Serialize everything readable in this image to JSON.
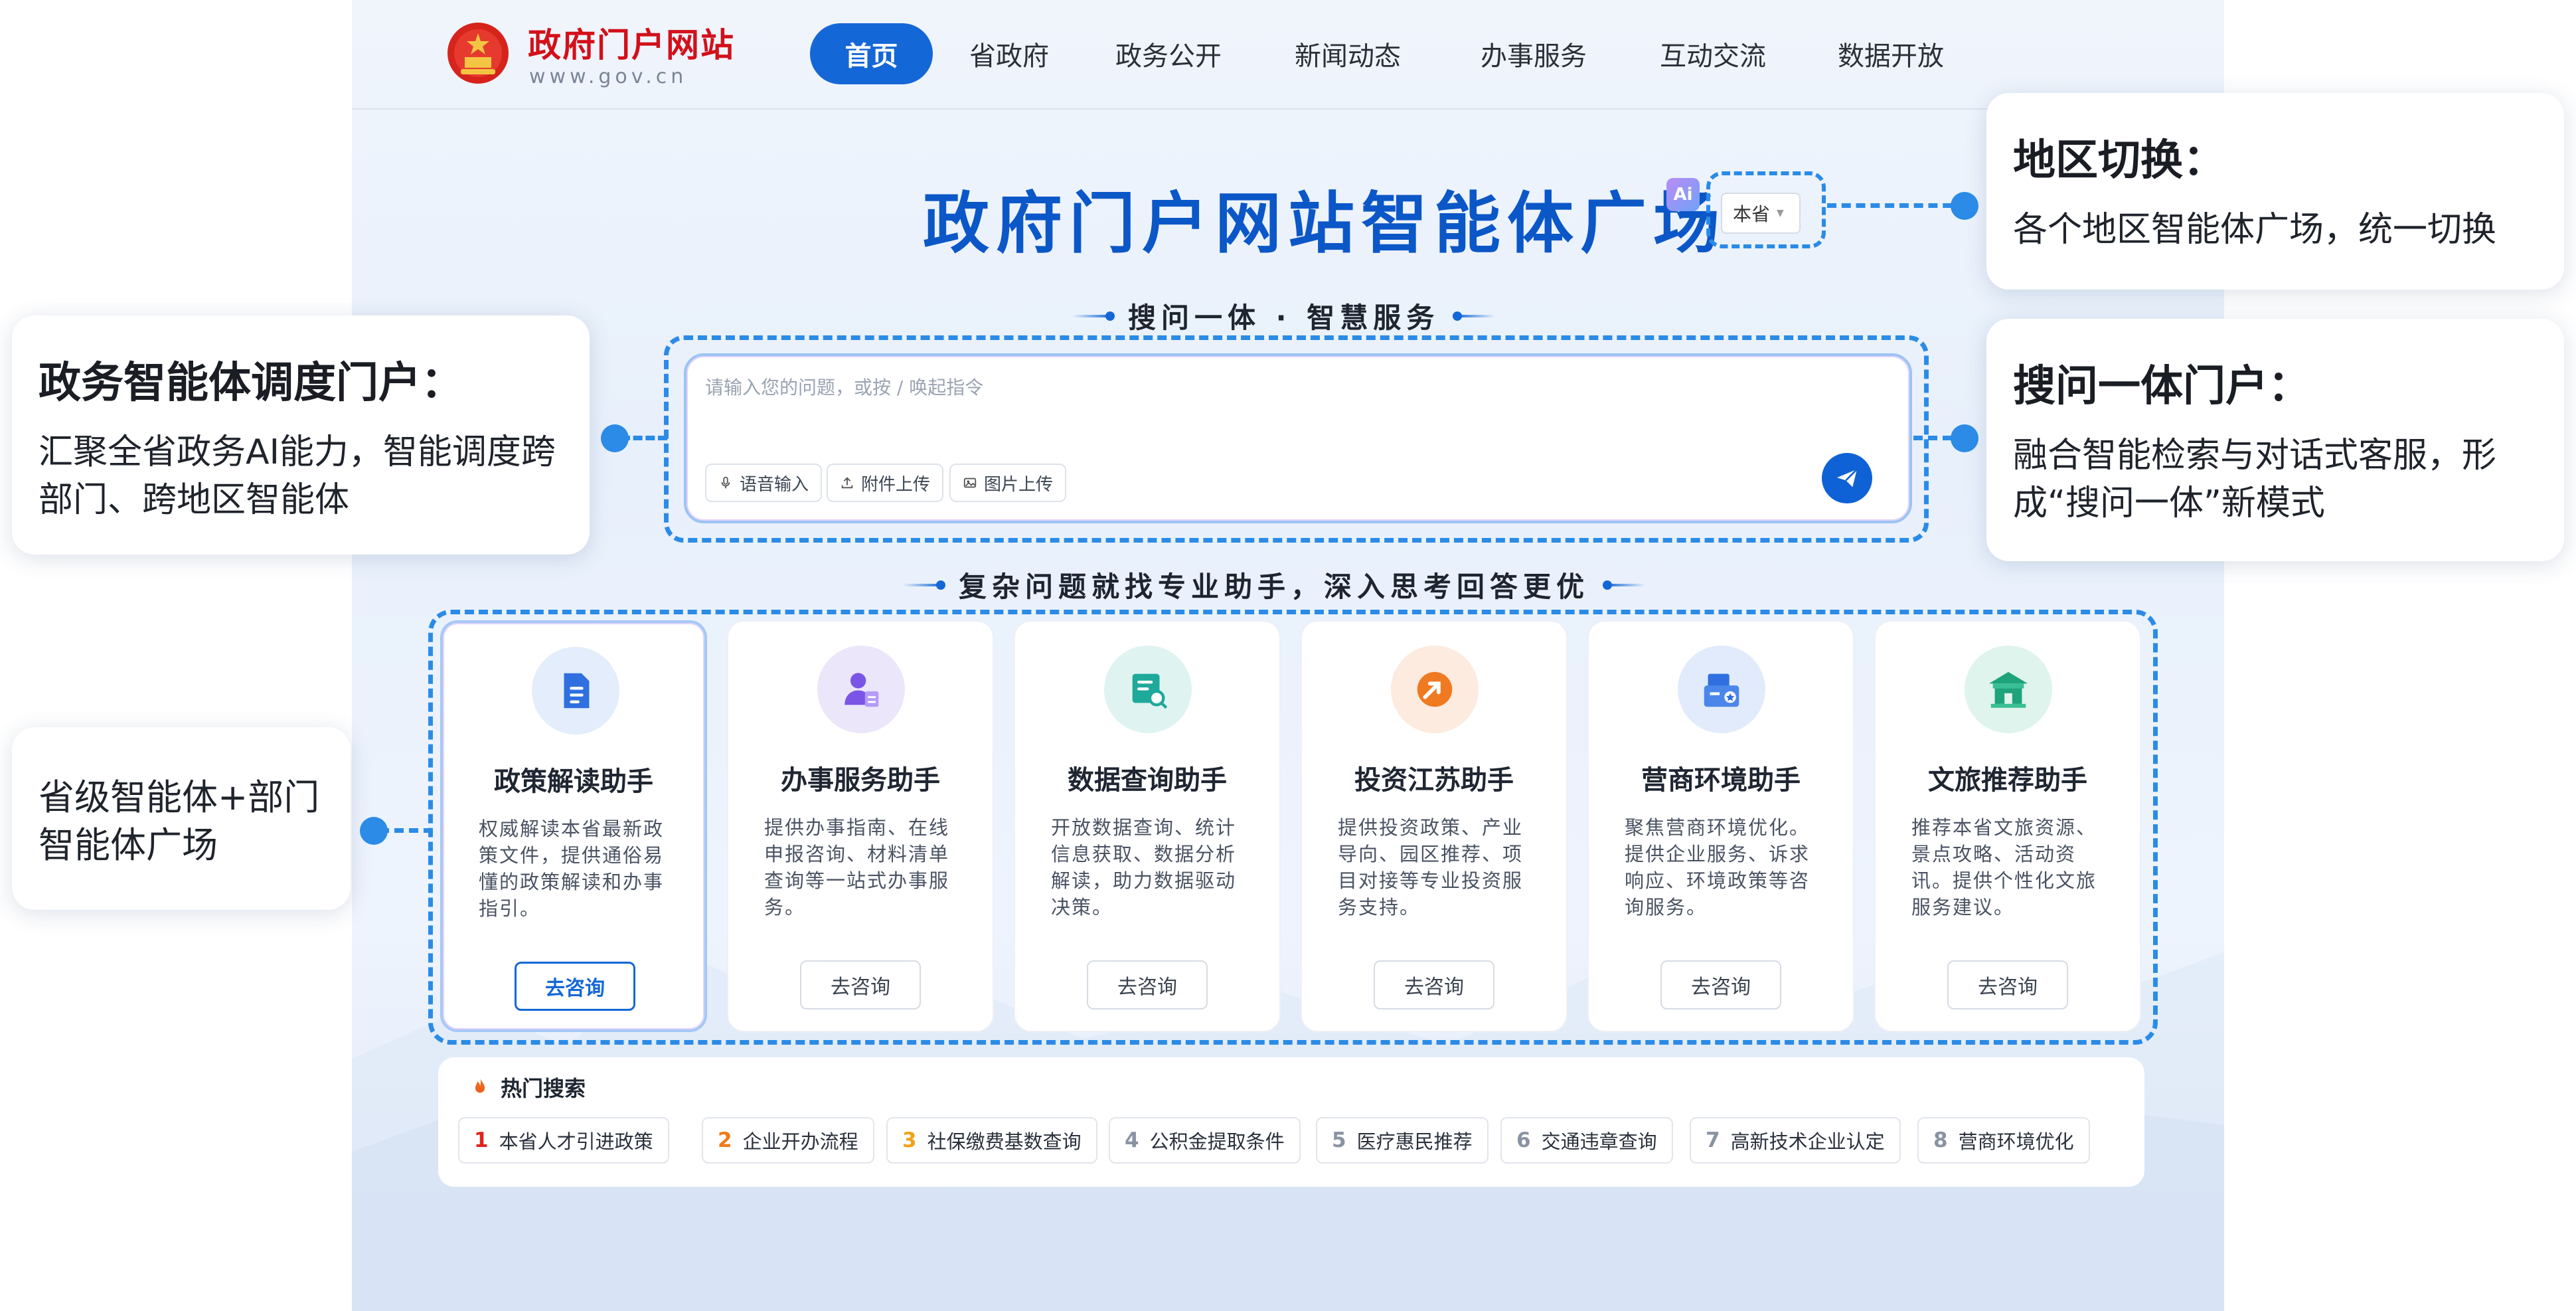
{
  "header": {
    "logo_title": "政府门户网站",
    "logo_subtitle": "www.gov.cn",
    "nav": [
      {
        "label": "首页",
        "active": true
      },
      {
        "label": "省政府",
        "active": false
      },
      {
        "label": "政务公开",
        "active": false
      },
      {
        "label": "新闻动态",
        "active": false
      },
      {
        "label": "办事服务",
        "active": false
      },
      {
        "label": "互动交流",
        "active": false
      },
      {
        "label": "数据开放",
        "active": false
      }
    ]
  },
  "hero": {
    "title": "政府门户网站智能体广场",
    "ai_badge": "Ai",
    "region_select": "本省"
  },
  "search": {
    "heading": "搜问一体 · 智慧服务",
    "placeholder": "请输入您的问题，或按 / 唤起指令",
    "chips": [
      {
        "label": "语音输入",
        "icon": "microphone-icon"
      },
      {
        "label": "附件上传",
        "icon": "upload-icon"
      },
      {
        "label": "图片上传",
        "icon": "image-icon"
      }
    ],
    "send_icon": "send-icon"
  },
  "assistants": {
    "heading": "复杂问题就找专业助手，深入思考回答更优",
    "cards": [
      {
        "title": "政策解读助手",
        "desc": "权威解读本省最新政策文件，提供通俗易懂的政策解读和办事指引。",
        "button": "去咨询",
        "icon": "document-icon",
        "selected": true
      },
      {
        "title": "办事服务助手",
        "desc": "提供办事指南、在线申报咨询、材料清单查询等一站式办事服务。",
        "button": "去咨询",
        "icon": "service-person-icon",
        "selected": false
      },
      {
        "title": "数据查询助手",
        "desc": "开放数据查询、统计信息获取、数据分析解读，助力数据驱动决策。",
        "button": "去咨询",
        "icon": "data-search-icon",
        "selected": false
      },
      {
        "title": "投资江苏助手",
        "desc": "提供投资政策、产业导向、园区推荐、项目对接等专业投资服务支持。",
        "button": "去咨询",
        "icon": "investment-arrow-icon",
        "selected": false
      },
      {
        "title": "营商环境助手",
        "desc": "聚焦营商环境优化。提供企业服务、诉求响应、环境政策等咨询服务。",
        "button": "去咨询",
        "icon": "business-icon",
        "selected": false
      },
      {
        "title": "文旅推荐助手",
        "desc": "推荐本省文旅资源、景点攻略、活动资讯。提供个性化文旅服务建议。",
        "button": "去咨询",
        "icon": "pavilion-icon",
        "selected": false
      }
    ]
  },
  "hot_search": {
    "title": "热门搜索",
    "items": [
      {
        "num": "1",
        "label": "本省人才引进政策",
        "color": "#e0231c"
      },
      {
        "num": "2",
        "label": "企业开办流程",
        "color": "#f07a16"
      },
      {
        "num": "3",
        "label": "社保缴费基数查询",
        "color": "#f0a316"
      },
      {
        "num": "4",
        "label": "公积金提取条件",
        "color": "#8a93a3"
      },
      {
        "num": "5",
        "label": "医疗惠民推荐",
        "color": "#8a93a3"
      },
      {
        "num": "6",
        "label": "交通违章查询",
        "color": "#8a93a3"
      },
      {
        "num": "7",
        "label": "高新技术企业认定",
        "color": "#8a93a3"
      },
      {
        "num": "8",
        "label": "营商环境优化",
        "color": "#8a93a3"
      }
    ]
  },
  "callouts": {
    "region": {
      "title": "地区切换：",
      "desc": "各个地区智能体广场，统一切换"
    },
    "search_portal": {
      "title": "搜问一体门户：",
      "desc": "融合智能检索与对话式客服，形成“搜问一体”新模式"
    },
    "dispatch": {
      "title": "政务智能体调度门户：",
      "desc": "汇聚全省政务AI能力，智能调度跨部门、跨地区智能体"
    },
    "plaza": {
      "title": "",
      "desc": "省级智能体+部门智能体广场"
    }
  },
  "colors": {
    "brand_blue": "#1467d6",
    "title_blue": "#0b57c8",
    "logo_red": "#d3101a",
    "dashed_blue": "#2b8be6"
  }
}
